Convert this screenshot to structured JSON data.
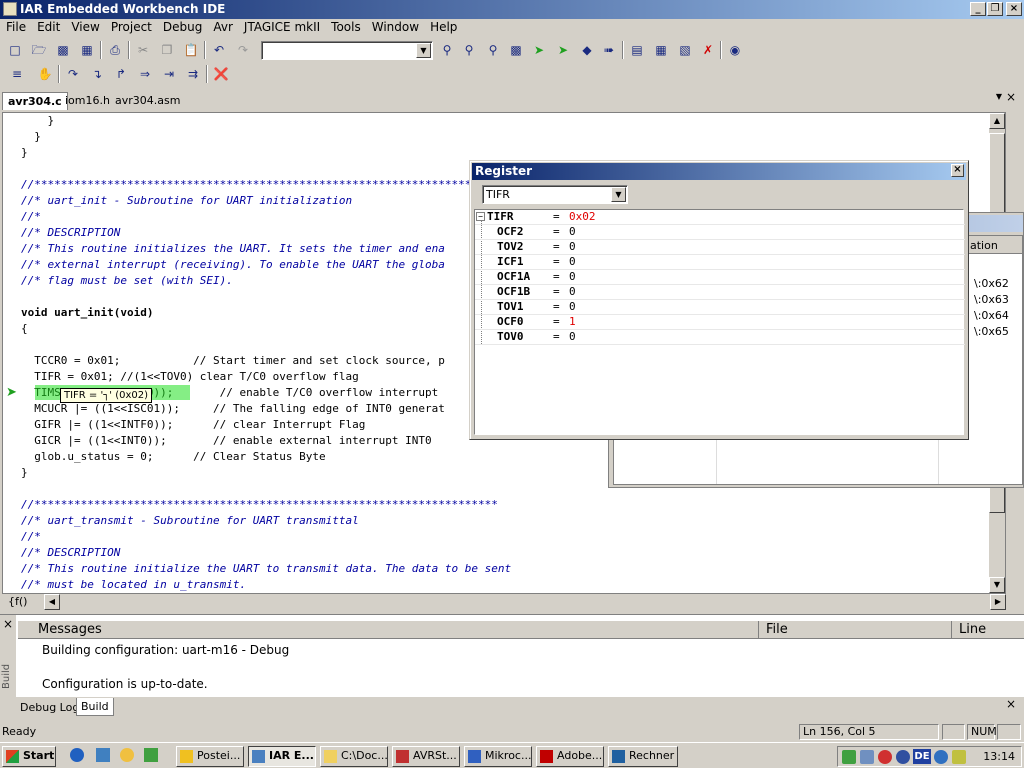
{
  "window": {
    "title": "IAR Embedded Workbench IDE",
    "min": "_",
    "max": "❐",
    "close": "×"
  },
  "menu": [
    "File",
    "Edit",
    "View",
    "Project",
    "Debug",
    "Avr",
    "JTAGICE mkII",
    "Tools",
    "Window",
    "Help"
  ],
  "toolbar": {
    "combo_value": ""
  },
  "tabs": [
    {
      "label": "avr304.c"
    },
    {
      "label": "iom16.h"
    },
    {
      "label": "avr304.asm"
    }
  ],
  "editor": {
    "lines": [
      "    }",
      "  }",
      "}",
      "",
      "//*************************************************************************",
      "//* uart_init - Subroutine for UART initialization",
      "//*",
      "//* DESCRIPTION",
      "//* This routine initializes the UART. It sets the timer and ena",
      "//* external interrupt (receiving). To enable the UART the globa",
      "//* flag must be set (with SEI).",
      "",
      "void uart_init(void)",
      "{",
      "",
      "  TCCR0 = 0x01;           // Start timer and set clock source, p",
      "  TIFR = 0x01; //(1<<TOV0) clear T/C0 overflow flag",
      "  TIMSK = ((1<<TOIE0));       // enable T/C0 overflow interrupt",
      "  MCUCR |= ((1<<ISC01));     // The falling edge of INT0 generat",
      "  GIFR |= ((1<<INTF0));      // clear Interrupt Flag",
      "  GICR |= ((1<<INT0));       // enable external interrupt INT0",
      "  glob.u_status = 0;      // Clear Status Byte",
      "}",
      "",
      "//**********************************************************************",
      "//* uart_transmit - Subroutine for UART transmittal",
      "//*",
      "//* DESCRIPTION",
      "//* This routine initialize the UART to transmit data. The data to be sent",
      "//* must be located in u_transmit."
    ],
    "tooltip": "TIFR = '┐' (0x02)",
    "func_combo": "{f()"
  },
  "register_window": {
    "title": "Register",
    "combo": "TIFR",
    "rows": [
      {
        "name": "TIFR",
        "value": "0x02",
        "changed": true
      },
      {
        "name": "OCF2",
        "value": "0",
        "changed": false
      },
      {
        "name": "TOV2",
        "value": "0",
        "changed": false
      },
      {
        "name": "ICF1",
        "value": "0",
        "changed": false
      },
      {
        "name": "OCF1A",
        "value": "0",
        "changed": false
      },
      {
        "name": "OCF1B",
        "value": "0",
        "changed": false
      },
      {
        "name": "TOV1",
        "value": "0",
        "changed": false
      },
      {
        "name": "OCF0",
        "value": "1",
        "changed": true
      },
      {
        "name": "TOV0",
        "value": "0",
        "changed": false
      }
    ]
  },
  "behind_window": {
    "header": "ation",
    "rows": [
      "\\:0x62",
      "\\:0x63",
      "\\:0x64",
      "\\:0x65"
    ]
  },
  "messages": {
    "columns": [
      "Messages",
      "File",
      "Line"
    ],
    "lines": [
      "Building configuration: uart-m16 - Debug",
      "",
      "Configuration is up-to-date."
    ],
    "side_label": "Build"
  },
  "bottom_tabs": [
    {
      "label": "Debug Log"
    },
    {
      "label": "Build"
    }
  ],
  "status": {
    "text": "Ready",
    "position": "Ln 156, Col 5",
    "num": "NUM"
  },
  "taskbar": {
    "start": "Start",
    "tasks": [
      {
        "label": "Postei...",
        "color": "#f0c020"
      },
      {
        "label": "IAR E...",
        "color": "#4a80c0",
        "active": true
      },
      {
        "label": "C:\\Doc...",
        "color": "#f0d060"
      },
      {
        "label": "AVRSt...",
        "color": "#c03030"
      },
      {
        "label": "Mikroc...",
        "color": "#3060c0"
      },
      {
        "label": "Adobe...",
        "color": "#c00000"
      },
      {
        "label": "Rechner",
        "color": "#2060a0"
      }
    ],
    "clock": "13:14",
    "lang": "DE"
  }
}
